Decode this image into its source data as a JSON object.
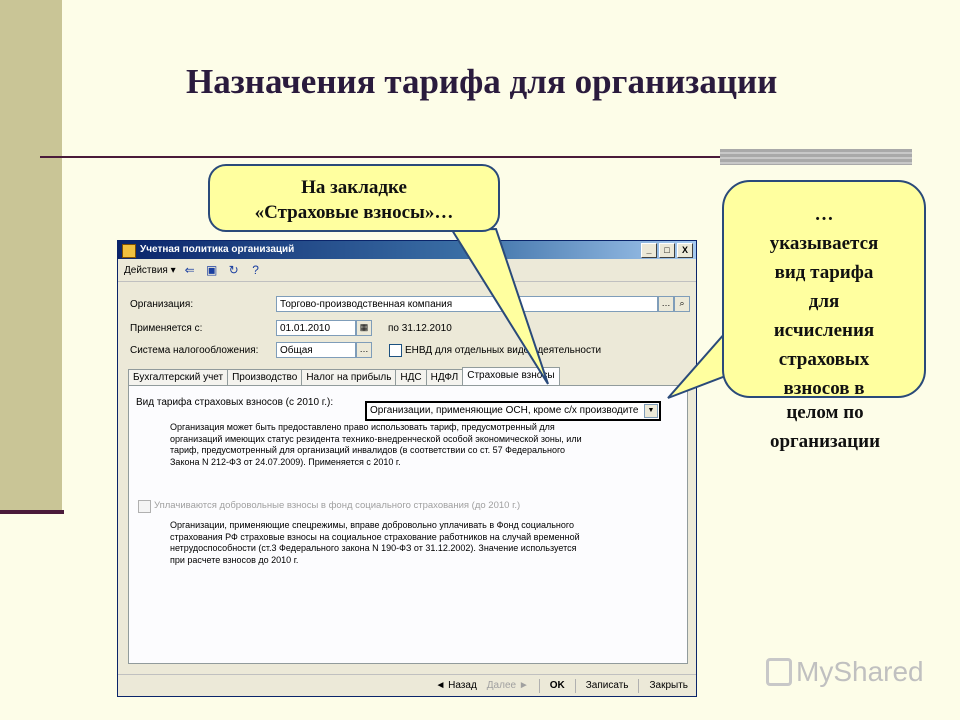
{
  "slide": {
    "title": "Назначения тарифа для организации"
  },
  "callouts": {
    "first": [
      "На закладке",
      "«Страховые взносы»…"
    ],
    "second": [
      "…",
      "указывается",
      "вид тарифа",
      "для",
      "исчисления",
      "страховых",
      "взносов в"
    ],
    "second_overflow": [
      "целом по",
      "организации"
    ]
  },
  "window": {
    "title": "Учетная политика организаций",
    "actions_label": "Действия ▾",
    "controls": [
      "_",
      "□",
      "X"
    ],
    "fields": {
      "org_label": "Организация:",
      "org_value": "Торгово-производственная компания",
      "applies_label": "Применяется с:",
      "applies_value": "01.01.2010",
      "applies_to": "по 31.12.2010",
      "tax_label": "Система налогообложения:",
      "tax_value": "Общая",
      "envd_label": "ЕНВД для отдельных видов деятельности"
    },
    "tabs": [
      "Бухгалтерский учет",
      "Производство",
      "Налог на прибыль",
      "НДС",
      "НДФЛ",
      "Страховые взносы"
    ],
    "active_tab": "Страховые взносы",
    "tariff_label": "Вид тарифа страховых взносов (с 2010 г.):",
    "tariff_value": "Организации, применяющие ОСН, кроме с/х производите",
    "tariff_description": [
      "Организация может быть предоставлено право использовать тариф, предусмотренный для",
      "организаций имеющих статус резидента технико-внедренческой особой экономической зоны, или",
      "тариф, предусмотренный для организаций инвалидов (в соответствии со ст. 57 Федерального",
      "Закона  N 212-ФЗ от 24.07.2009). Применяется с 2010 г."
    ],
    "voluntary_label": "Уплачиваются добровольные взносы в фонд социального страхования (до 2010 г.)",
    "voluntary_description": [
      "Организации, применяющие спецрежимы, вправе добровольно уплачивать в Фонд социального",
      "страхования РФ страховые взносы на социальное страхование работников на случай временной",
      "нетрудоспособности (ст.3 Федерального закона N 190-ФЗ от 31.12.2002). Значение используется",
      "при расчете взносов до 2010 г."
    ],
    "bottom_buttons": {
      "back": "◄ Назад",
      "next": "Далее ►",
      "ok": "OK",
      "save": "Записать",
      "close": "Закрыть"
    }
  },
  "watermark": {
    "text": "MyShared"
  },
  "colors": {
    "background": "#fdfde8",
    "left_bar": "#c9c596",
    "callout_fill": "#ffff9f",
    "title_color": "#2a1b3d"
  }
}
